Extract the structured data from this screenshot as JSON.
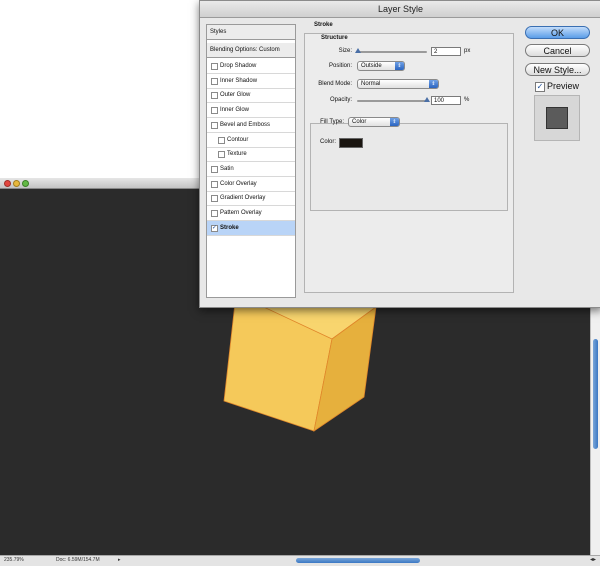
{
  "dialog": {
    "title": "Layer Style",
    "styles_list": {
      "header": "Styles",
      "blending_options": "Blending Options: Custom",
      "items": [
        {
          "label": "Drop Shadow",
          "checked": false,
          "indent": false
        },
        {
          "label": "Inner Shadow",
          "checked": false,
          "indent": false
        },
        {
          "label": "Outer Glow",
          "checked": false,
          "indent": false
        },
        {
          "label": "Inner Glow",
          "checked": false,
          "indent": false
        },
        {
          "label": "Bevel and Emboss",
          "checked": false,
          "indent": false
        },
        {
          "label": "Contour",
          "checked": false,
          "indent": true
        },
        {
          "label": "Texture",
          "checked": false,
          "indent": true
        },
        {
          "label": "Satin",
          "checked": false,
          "indent": false
        },
        {
          "label": "Color Overlay",
          "checked": false,
          "indent": false
        },
        {
          "label": "Gradient Overlay",
          "checked": false,
          "indent": false
        },
        {
          "label": "Pattern Overlay",
          "checked": false,
          "indent": false
        },
        {
          "label": "Stroke",
          "checked": true,
          "indent": false,
          "selected": true
        }
      ]
    },
    "stroke": {
      "title": "Stroke",
      "structure_title": "Structure",
      "size_label": "Size:",
      "size_value": "2",
      "size_unit": "px",
      "position_label": "Position:",
      "position_value": "Outside",
      "blend_mode_label": "Blend Mode:",
      "blend_mode_value": "Normal",
      "opacity_label": "Opacity:",
      "opacity_value": "100",
      "opacity_unit": "%",
      "fill_type_label": "Fill Type:",
      "fill_type_value": "Color",
      "color_label": "Color:",
      "stroke_color": "#1a1510"
    },
    "buttons": {
      "ok": "OK",
      "cancel": "Cancel",
      "new_style": "New Style...",
      "preview_label": "Preview",
      "preview_checked": true
    }
  },
  "document": {
    "zoom": "235.79%",
    "doc_size": "Doc: 6.59M/154.7M",
    "canvas_color": "#2b2b2b",
    "box_colors": {
      "front": "#f5c95a",
      "side": "#e6b03d",
      "top": "#f8d56e",
      "edge": "#e0862a"
    }
  }
}
